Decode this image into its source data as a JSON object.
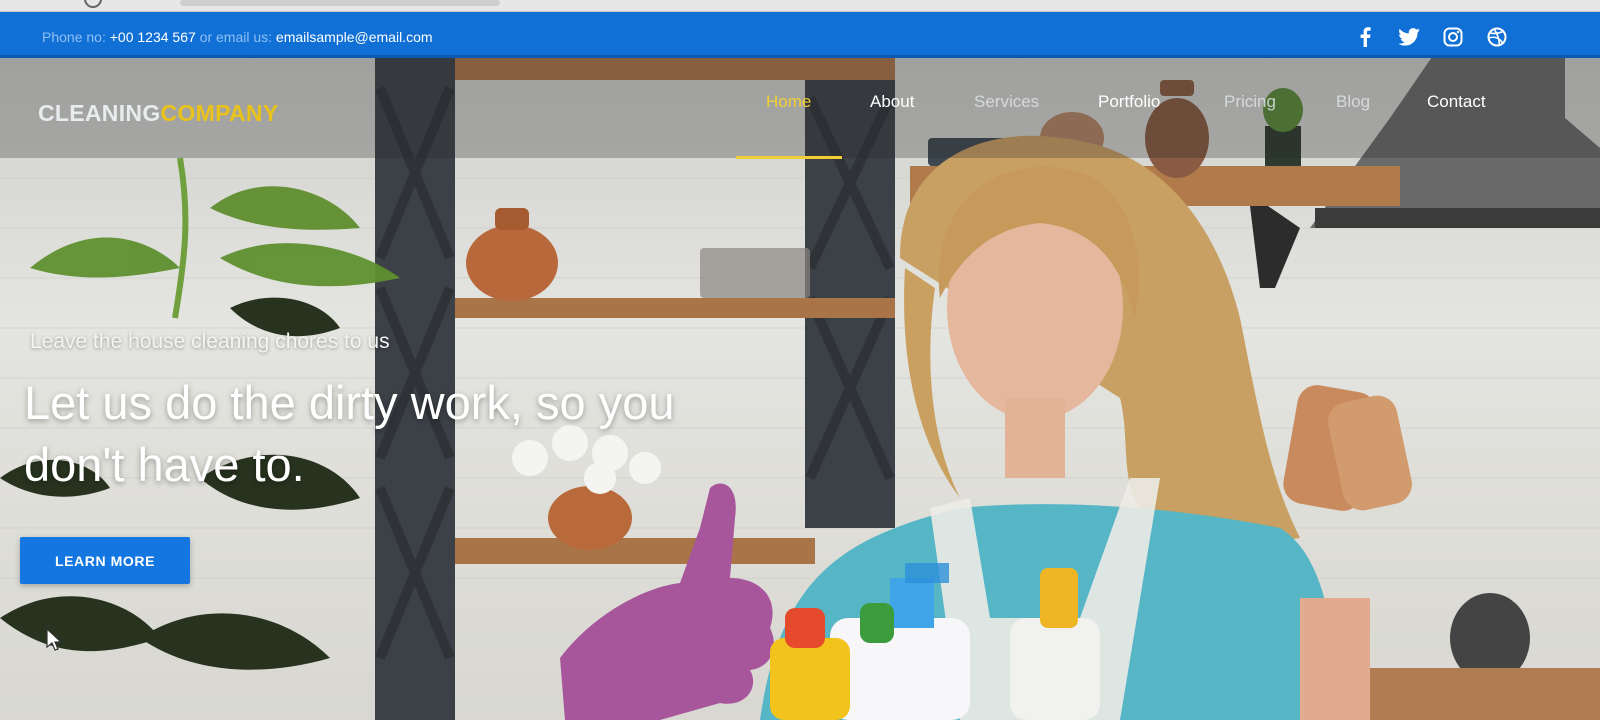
{
  "topbar": {
    "phone_label": "Phone no:",
    "phone_number": "+00 1234 567",
    "or_label": "or",
    "email_label": "email us:",
    "email": "emailsample@email.com",
    "socials": [
      {
        "icon": "facebook-icon"
      },
      {
        "icon": "twitter-icon"
      },
      {
        "icon": "instagram-icon"
      },
      {
        "icon": "dribbble-icon"
      }
    ]
  },
  "brand": {
    "part1": "CLEANING",
    "part2": "COMPANY"
  },
  "nav": {
    "items": [
      {
        "label": "Home"
      },
      {
        "label": "About"
      },
      {
        "label": "Services"
      },
      {
        "label": "Portfolio"
      },
      {
        "label": "Pricing"
      },
      {
        "label": "Blog"
      },
      {
        "label": "Contact"
      }
    ],
    "active": "Home"
  },
  "hero": {
    "subtitle": "Leave the house cleaning chores to us",
    "title": "Let us do the dirty work, so you don't have to.",
    "cta": "LEARN MORE"
  },
  "colors": {
    "topbar": "#1170d6",
    "accent": "#f1cf34",
    "button": "#1476e0"
  }
}
